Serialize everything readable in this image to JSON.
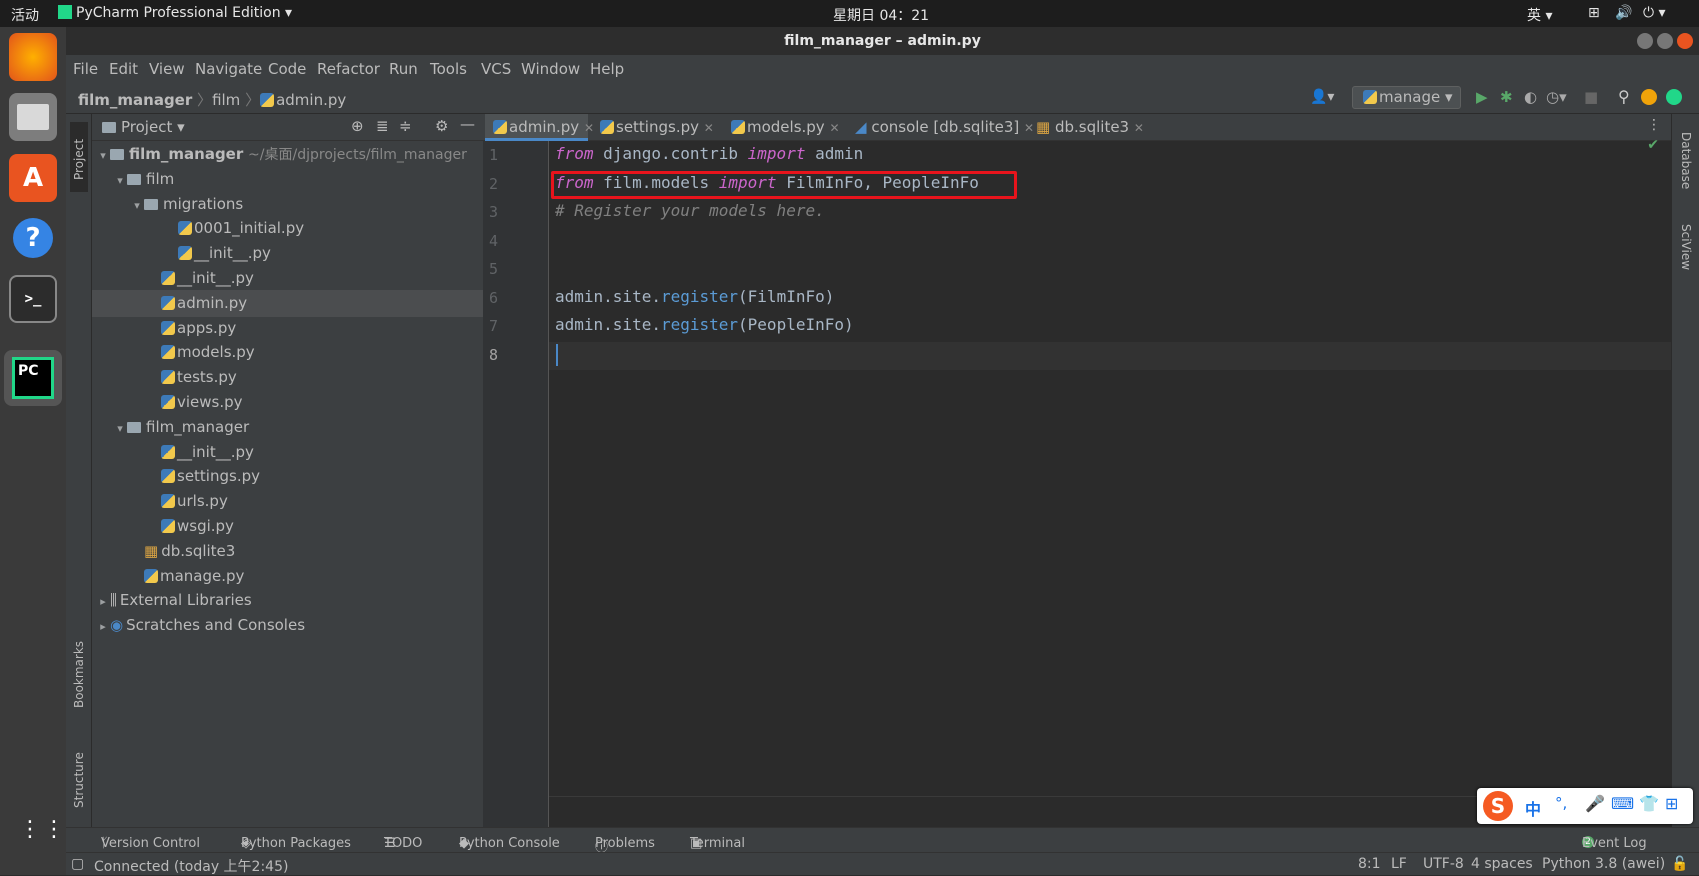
{
  "topbar": {
    "activities": "活动",
    "app_name": "PyCharm Professional Edition",
    "clock": "星期日 04：21",
    "input_method": "英"
  },
  "window": {
    "title": "film_manager – admin.py"
  },
  "menu": [
    "File",
    "Edit",
    "View",
    "Navigate",
    "Code",
    "Refactor",
    "Run",
    "Tools",
    "VCS",
    "Window",
    "Help"
  ],
  "breadcrumb": [
    "film_manager",
    "film",
    "admin.py"
  ],
  "run_config": "manage",
  "project_panel": {
    "title": "Project",
    "root_name": "film_manager",
    "root_path": "~/桌面/djprojects/film_manager",
    "rows": [
      {
        "label": "film",
        "depth": 1,
        "kind": "folder",
        "open": true
      },
      {
        "label": "migrations",
        "depth": 2,
        "kind": "folder",
        "open": true
      },
      {
        "label": "0001_initial.py",
        "depth": 4,
        "kind": "py"
      },
      {
        "label": "__init__.py",
        "depth": 4,
        "kind": "py"
      },
      {
        "label": "__init__.py",
        "depth": 3,
        "kind": "py"
      },
      {
        "label": "admin.py",
        "depth": 3,
        "kind": "py",
        "selected": true
      },
      {
        "label": "apps.py",
        "depth": 3,
        "kind": "py"
      },
      {
        "label": "models.py",
        "depth": 3,
        "kind": "py"
      },
      {
        "label": "tests.py",
        "depth": 3,
        "kind": "py"
      },
      {
        "label": "views.py",
        "depth": 3,
        "kind": "py"
      },
      {
        "label": "film_manager",
        "depth": 1,
        "kind": "folder",
        "open": true
      },
      {
        "label": "__init__.py",
        "depth": 3,
        "kind": "py"
      },
      {
        "label": "settings.py",
        "depth": 3,
        "kind": "py"
      },
      {
        "label": "urls.py",
        "depth": 3,
        "kind": "py"
      },
      {
        "label": "wsgi.py",
        "depth": 3,
        "kind": "py"
      },
      {
        "label": "db.sqlite3",
        "depth": 2,
        "kind": "db"
      },
      {
        "label": "manage.py",
        "depth": 2,
        "kind": "py"
      },
      {
        "label": "External Libraries",
        "depth": 0,
        "kind": "lib",
        "open": false
      },
      {
        "label": "Scratches and Consoles",
        "depth": 0,
        "kind": "scratch",
        "open": false
      }
    ]
  },
  "tabs": [
    {
      "label": "admin.py",
      "active": true
    },
    {
      "label": "settings.py"
    },
    {
      "label": "models.py"
    },
    {
      "label": "console [db.sqlite3]"
    },
    {
      "label": "db.sqlite3"
    }
  ],
  "code_lines": [
    "1",
    "2",
    "3",
    "4",
    "5",
    "6",
    "7",
    "8"
  ],
  "code": {
    "l1_kw1": "from",
    "l1_mid": " django.contrib ",
    "l1_kw2": "import",
    "l1_end": " admin",
    "l2_kw1": "from",
    "l2_mid": " film.models ",
    "l2_kw2": "import",
    "l2_end": " FilmInFo, PeopleInFo",
    "l3": "# Register your models here.",
    "l6_pre": "admin.site.",
    "l6_fn": "register",
    "l6_arg": "(FilmInFo)",
    "l7_pre": "admin.site.",
    "l7_fn": "register",
    "l7_arg": "(PeopleInFo)"
  },
  "side_labels": {
    "project": "Project",
    "bookmarks": "Bookmarks",
    "structure": "Structure",
    "database": "Database",
    "sciview": "SciView"
  },
  "bottom_tools": [
    "Version Control",
    "Python Packages",
    "TODO",
    "Python Console",
    "Problems",
    "Terminal"
  ],
  "event_log": "Event Log",
  "status": {
    "left": "Connected (today 上午2:45)",
    "pos": "8:1",
    "eol": "LF",
    "enc": "UTF-8",
    "indent": "4 spaces",
    "interp": "Python 3.8 (awei)"
  },
  "ime_bar": {
    "lang": "中",
    "punct": "°,"
  },
  "colors": {
    "highlight_box": "#e8141c",
    "active_tab_underline": "#4a88c7"
  }
}
